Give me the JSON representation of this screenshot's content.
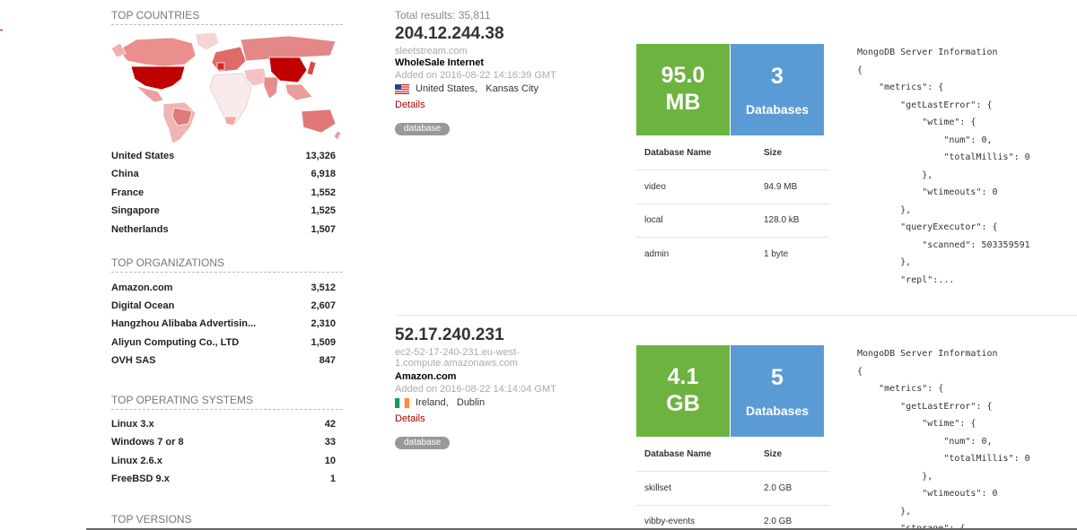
{
  "sidebar": {
    "top_countries": {
      "title": "TOP COUNTRIES",
      "rows": [
        {
          "name": "United States",
          "count": "13,326"
        },
        {
          "name": "China",
          "count": "6,918"
        },
        {
          "name": "France",
          "count": "1,552"
        },
        {
          "name": "Singapore",
          "count": "1,525"
        },
        {
          "name": "Netherlands",
          "count": "1,507"
        }
      ]
    },
    "top_organizations": {
      "title": "TOP ORGANIZATIONS",
      "rows": [
        {
          "name": "Amazon.com",
          "count": "3,512"
        },
        {
          "name": "Digital Ocean",
          "count": "2,607"
        },
        {
          "name": "Hangzhou Alibaba Advertisin...",
          "count": "2,310"
        },
        {
          "name": "Aliyun Computing Co., LTD",
          "count": "1,509"
        },
        {
          "name": "OVH SAS",
          "count": "847"
        }
      ]
    },
    "top_os": {
      "title": "TOP OPERATING SYSTEMS",
      "rows": [
        {
          "name": "Linux 3.x",
          "count": "42"
        },
        {
          "name": "Windows 7 or 8",
          "count": "33"
        },
        {
          "name": "Linux 2.6.x",
          "count": "10"
        },
        {
          "name": "FreeBSD 9.x",
          "count": "1"
        }
      ]
    },
    "top_versions": {
      "title": "TOP VERSIONS"
    }
  },
  "results": {
    "total_label": "Total results: 35,811",
    "items": [
      {
        "ip": "204.12.244.38",
        "hostname": "sleetstream.com",
        "org": "WholeSale Internet",
        "added": "Added on 2016-08-22 14:16:39 GMT",
        "country": "United States",
        "city": "Kansas City",
        "flag": "us-flag",
        "details": "Details",
        "tag": "database",
        "size_value": "95.0",
        "size_unit": "MB",
        "db_count": "3",
        "db_label": "Databases",
        "table_headers": {
          "name": "Database Name",
          "size": "Size"
        },
        "dbs": [
          {
            "name": "video",
            "size": "94.9 MB"
          },
          {
            "name": "local",
            "size": "128.0 kB"
          },
          {
            "name": "admin",
            "size": "1 byte"
          }
        ],
        "json": "MongoDB Server Information\n{\n    \"metrics\": {\n        \"getLastError\": {\n            \"wtime\": {\n                \"num\": 0,\n                \"totalMillis\": 0\n            },\n            \"wtimeouts\": 0\n        },\n        \"queryExecutor\": {\n            \"scanned\": 503359591\n        },\n        \"repl\":..."
      },
      {
        "ip": "52.17.240.231",
        "hostname": "ec2-52-17-240-231.eu-west-1.compute.amazonaws.com",
        "hostname_line1": "ec2-52-17-240-231.eu-west-",
        "hostname_line2": "1.compute.amazonaws.com",
        "org": "Amazon.com",
        "added": "Added on 2016-08-22 14:14:04 GMT",
        "country": "Ireland",
        "city": "Dublin",
        "flag": "ie-flag",
        "details": "Details",
        "tag": "database",
        "size_value": "4.1",
        "size_unit": "GB",
        "db_count": "5",
        "db_label": "Databases",
        "table_headers": {
          "name": "Database Name",
          "size": "Size"
        },
        "dbs": [
          {
            "name": "skillset",
            "size": "2.0 GB"
          },
          {
            "name": "vibby-events",
            "size": "2.0 GB"
          }
        ],
        "json": "MongoDB Server Information\n{\n    \"metrics\": {\n        \"getLastError\": {\n            \"wtime\": {\n                \"num\": 0,\n                \"totalMillis\": 0\n            },\n            \"wtimeouts\": 0\n        },\n        \"storage\": {"
      }
    ]
  },
  "colors": {
    "accent_green": "#6cb33f",
    "accent_blue": "#5b9bd5",
    "details_red": "#aa0000",
    "map_dark": "#c00000",
    "map_light": "#f2b8b8"
  }
}
